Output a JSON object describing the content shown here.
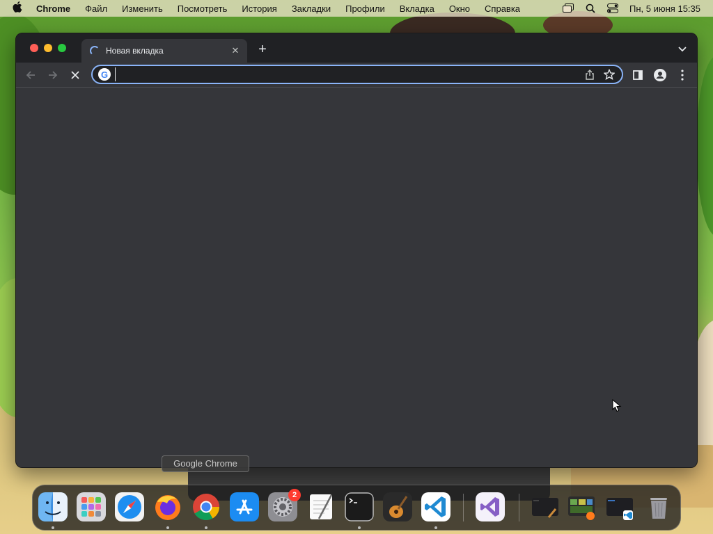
{
  "menubar": {
    "app": "Chrome",
    "items": [
      "Файл",
      "Изменить",
      "Посмотреть",
      "История",
      "Закладки",
      "Профили",
      "Вкладка",
      "Окно",
      "Справка"
    ],
    "clock": "Пн, 5 июня  15:35",
    "status_icons": [
      "window-stack-icon",
      "spotlight-search-icon",
      "control-center-icon"
    ]
  },
  "window": {
    "tab": {
      "title": "Новая вкладка",
      "state": "loading"
    },
    "omnibox": {
      "value": "",
      "placeholder": ""
    },
    "toolbar_icons": [
      "back-arrow-icon",
      "forward-arrow-icon",
      "stop-icon",
      "share-icon",
      "bookmark-star-icon",
      "side-panel-icon",
      "profile-icon",
      "menu-kebab-icon"
    ]
  },
  "tooltip": {
    "text": "Google Chrome"
  },
  "dock": {
    "apps": [
      "Finder",
      "Launchpad",
      "Safari",
      "Firefox",
      "Google Chrome",
      "App Store",
      "System Settings",
      "TextEdit",
      "Terminal",
      "GarageBand",
      "Visual Studio Code",
      "Visual Studio"
    ],
    "settings_badge": "2"
  }
}
